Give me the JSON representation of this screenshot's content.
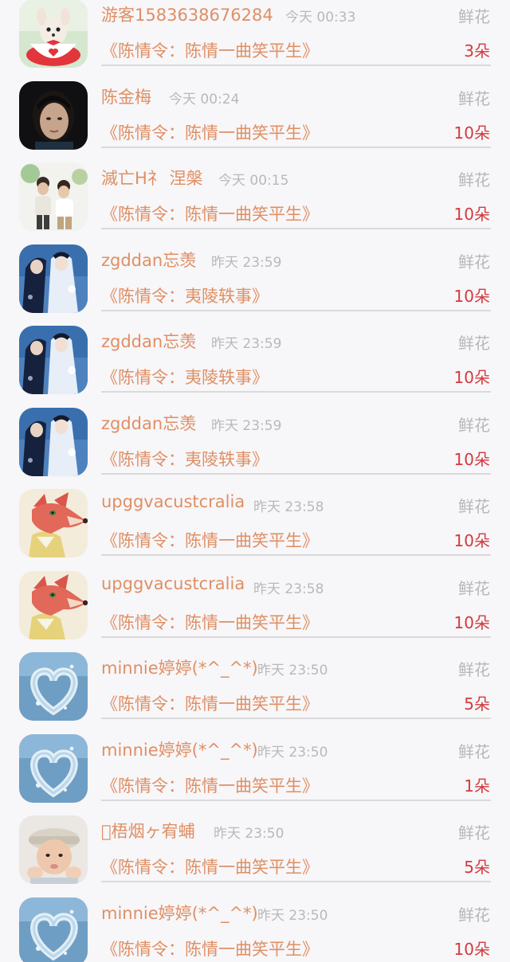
{
  "gift_records": [
    {
      "name": "游客1583638676284",
      "time": "今天 00:33",
      "gift": "鲜花",
      "work": "《陈情令：陈情一曲笑平生》",
      "count": "3朵",
      "avatar": "puppy-teacup"
    },
    {
      "name": "陈金梅",
      "time": "今天 00:24",
      "gift": "鲜花",
      "work": "《陈情令：陈情一曲笑平生》",
      "count": "10朵",
      "avatar": "girl-dark"
    },
    {
      "name": "滅亡H礻 涅槃",
      "time": "今天 00:15",
      "gift": "鲜花",
      "work": "《陈情令：陈情一曲笑平生》",
      "count": "10朵",
      "avatar": "two-boys"
    },
    {
      "name": "zgddan忘羡",
      "time": "昨天 23:59",
      "gift": "鲜花",
      "work": "《陈情令：夷陵轶事》",
      "count": "10朵",
      "avatar": "costume-pair"
    },
    {
      "name": "zgddan忘羡",
      "time": "昨天 23:59",
      "gift": "鲜花",
      "work": "《陈情令：夷陵轶事》",
      "count": "10朵",
      "avatar": "costume-pair"
    },
    {
      "name": "zgddan忘羡",
      "time": "昨天 23:59",
      "gift": "鲜花",
      "work": "《陈情令：夷陵轶事》",
      "count": "10朵",
      "avatar": "costume-pair"
    },
    {
      "name": "upggvacustcralia",
      "time": "昨天 23:58",
      "gift": "鲜花",
      "work": "《陈情令：陈情一曲笑平生》",
      "count": "10朵",
      "avatar": "cartoon-fox"
    },
    {
      "name": "upggvacustcralia",
      "time": "昨天 23:58",
      "gift": "鲜花",
      "work": "《陈情令：陈情一曲笑平生》",
      "count": "10朵",
      "avatar": "cartoon-fox"
    },
    {
      "name": "minnie婷婷(*^_^*)",
      "time": "昨天 23:50",
      "gift": "鲜花",
      "work": "《陈情令：陈情一曲笑平生》",
      "count": "5朵",
      "avatar": "water-heart"
    },
    {
      "name": "minnie婷婷(*^_^*)",
      "time": "昨天 23:50",
      "gift": "鲜花",
      "work": "《陈情令：陈情一曲笑平生》",
      "count": "1朵",
      "avatar": "water-heart"
    },
    {
      "name": "\u0000梧烟ヶ宥蜅",
      "time": "昨天 23:50",
      "gift": "鲜花",
      "work": "《陈情令：陈情一曲笑平生》",
      "count": "5朵",
      "avatar": "child-cap"
    },
    {
      "name": "minnie婷婷(*^_^*)",
      "time": "昨天 23:50",
      "gift": "鲜花",
      "work": "《陈情令：陈情一曲笑平生》",
      "count": "10朵",
      "avatar": "water-heart"
    }
  ],
  "colors": {
    "name": "#df8f64",
    "time": "#b9b9b9",
    "gift_label": "#b7b7b7",
    "count": "#d33a3e",
    "divider": "#dadada",
    "background": "#f7f6f8"
  }
}
